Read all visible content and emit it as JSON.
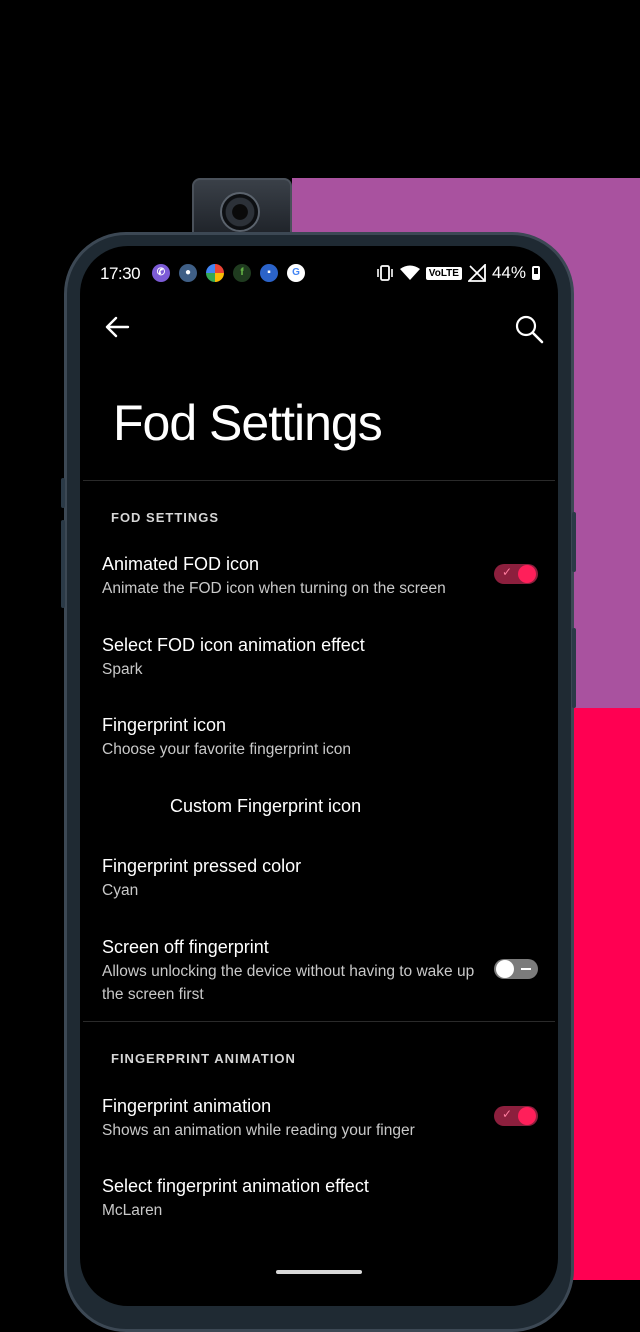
{
  "status_bar": {
    "time": "17:30",
    "notification_icons": [
      "viber-icon",
      "steam-icon",
      "photos-icon",
      "feedly-icon",
      "gallery-icon",
      "google-icon"
    ],
    "volte": "VoLTE",
    "battery": "44%"
  },
  "header": {
    "title": "Fod Settings"
  },
  "sections": [
    {
      "header": "FOD SETTINGS",
      "items": [
        {
          "title": "Animated FOD icon",
          "subtitle": "Animate the FOD icon when turning on the screen",
          "toggle": "on"
        },
        {
          "title": "Select FOD icon animation effect",
          "subtitle": "Spark"
        },
        {
          "title": "Fingerprint icon",
          "subtitle": "Choose your favorite fingerprint icon"
        },
        {
          "title": "Custom Fingerprint icon"
        },
        {
          "title": "Fingerprint pressed color",
          "subtitle": "Cyan"
        },
        {
          "title": "Screen off fingerprint",
          "subtitle": "Allows unlocking the device without having to wake up the screen first",
          "toggle": "off"
        }
      ]
    },
    {
      "header": "FINGERPRINT ANIMATION",
      "items": [
        {
          "title": "Fingerprint animation",
          "subtitle": "Shows an animation while reading your finger",
          "toggle": "on"
        },
        {
          "title": "Select fingerprint animation effect",
          "subtitle": "McLaren"
        }
      ]
    }
  ],
  "colors": {
    "accent": "#ff1f5a",
    "background": "#000000",
    "wallpaper_purple": "#a9529f",
    "wallpaper_pink": "#ff0052"
  }
}
